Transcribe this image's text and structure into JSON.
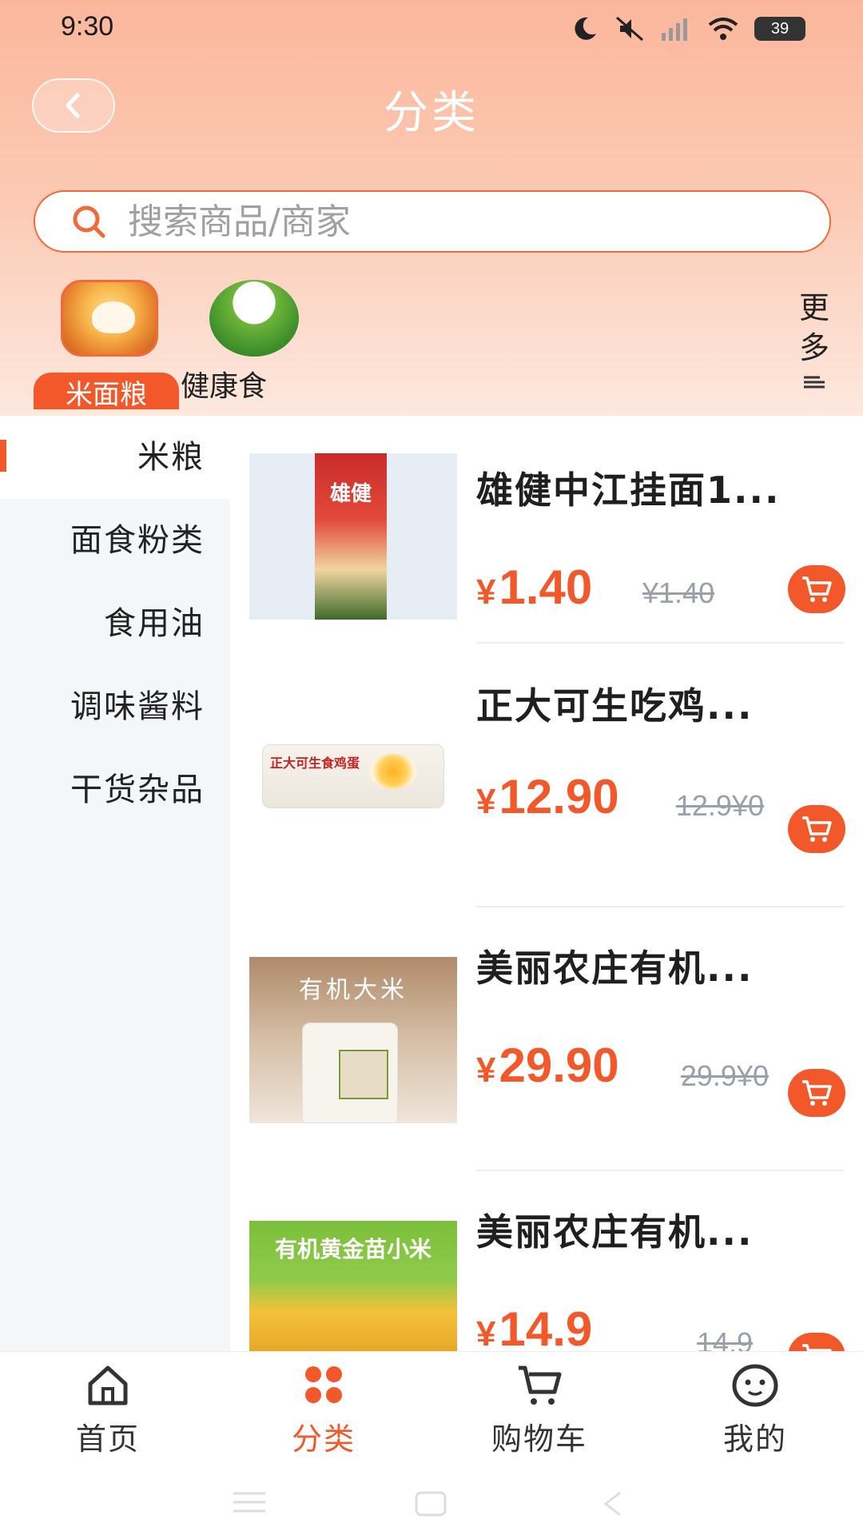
{
  "status_bar": {
    "time": "9:30",
    "battery": "39"
  },
  "header": {
    "title": "分类",
    "back_icon": "chevron-left-icon"
  },
  "search": {
    "placeholder": "搜索商品/商家",
    "icon": "search-icon"
  },
  "categories": [
    {
      "label": "米面粮",
      "active": true
    },
    {
      "label": "健康食",
      "active": false
    }
  ],
  "more": {
    "label": "更多"
  },
  "sidebar": {
    "items": [
      {
        "label": "米粮",
        "active": true
      },
      {
        "label": "面食粉类",
        "active": false
      },
      {
        "label": "食用油",
        "active": false
      },
      {
        "label": "调味酱料",
        "active": false
      },
      {
        "label": "干货杂品",
        "active": false
      }
    ]
  },
  "products": [
    {
      "name": "雄健中江挂面1...",
      "currency": "¥",
      "price": "1.40",
      "original": "¥1.40"
    },
    {
      "name": "正大可生吃鸡...",
      "currency": "¥",
      "price": "12.90",
      "original": "12.9¥0"
    },
    {
      "name": "美丽农庄有机...",
      "currency": "¥",
      "price": "29.90",
      "original": "29.9¥0"
    },
    {
      "name": "美丽农庄有机...",
      "currency": "¥",
      "price": "14.9",
      "original": "14.9"
    }
  ],
  "product_images": [
    {
      "caption": "雄健"
    },
    {
      "caption": "正大可生食鸡蛋"
    },
    {
      "caption": "有机大米"
    },
    {
      "caption": "有机黄金苗小米"
    }
  ],
  "tabbar": {
    "items": [
      {
        "label": "首页",
        "icon": "home-icon",
        "active": false
      },
      {
        "label": "分类",
        "icon": "category-icon",
        "active": true
      },
      {
        "label": "购物车",
        "icon": "cart-icon",
        "active": false
      },
      {
        "label": "我的",
        "icon": "profile-icon",
        "active": false
      }
    ]
  },
  "colors": {
    "accent": "#f2582a",
    "header_top": "#fbb79c",
    "sidebar_bg": "#f4f6f8"
  }
}
